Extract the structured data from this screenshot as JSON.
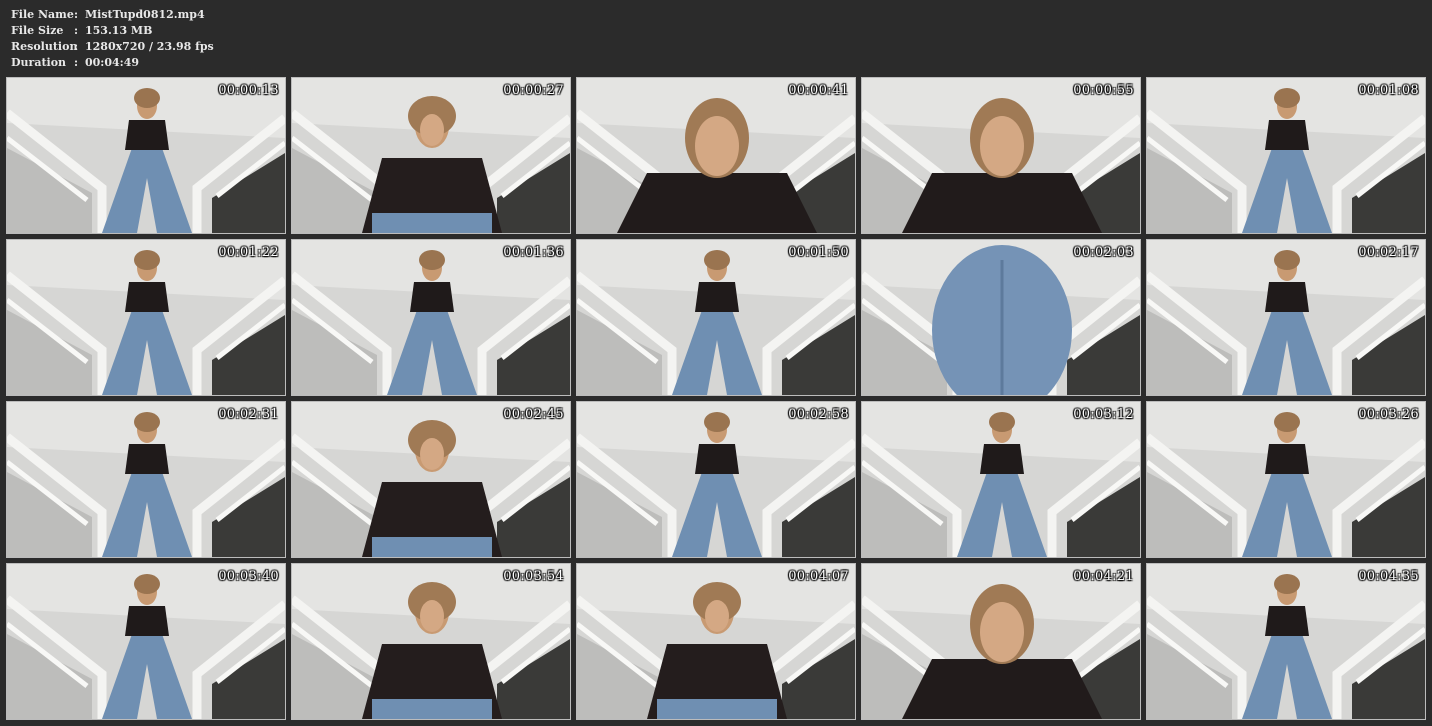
{
  "info": {
    "file_name_label": "File Name",
    "file_name_value": "MistTupd0812.mp4",
    "file_size_label": "File Size",
    "file_size_value": "153.13 MB",
    "resolution_label": "Resolution",
    "resolution_value": "1280x720 / 23.98 fps",
    "duration_label": "Duration",
    "duration_value": "00:04:49",
    "separator": ":"
  },
  "thumbnails": [
    {
      "timestamp": "00:00:13",
      "pose": "wide"
    },
    {
      "timestamp": "00:00:27",
      "pose": "crouch"
    },
    {
      "timestamp": "00:00:41",
      "pose": "close"
    },
    {
      "timestamp": "00:00:55",
      "pose": "close"
    },
    {
      "timestamp": "00:01:08",
      "pose": "wide"
    },
    {
      "timestamp": "00:01:22",
      "pose": "wide"
    },
    {
      "timestamp": "00:01:36",
      "pose": "back"
    },
    {
      "timestamp": "00:01:50",
      "pose": "back"
    },
    {
      "timestamp": "00:02:03",
      "pose": "back-close"
    },
    {
      "timestamp": "00:02:17",
      "pose": "wide"
    },
    {
      "timestamp": "00:02:31",
      "pose": "wide"
    },
    {
      "timestamp": "00:02:45",
      "pose": "crouch"
    },
    {
      "timestamp": "00:02:58",
      "pose": "wide"
    },
    {
      "timestamp": "00:03:12",
      "pose": "wide"
    },
    {
      "timestamp": "00:03:26",
      "pose": "wide"
    },
    {
      "timestamp": "00:03:40",
      "pose": "wide"
    },
    {
      "timestamp": "00:03:54",
      "pose": "crouch"
    },
    {
      "timestamp": "00:04:07",
      "pose": "crouch"
    },
    {
      "timestamp": "00:04:21",
      "pose": "close"
    },
    {
      "timestamp": "00:04:35",
      "pose": "wide"
    }
  ]
}
